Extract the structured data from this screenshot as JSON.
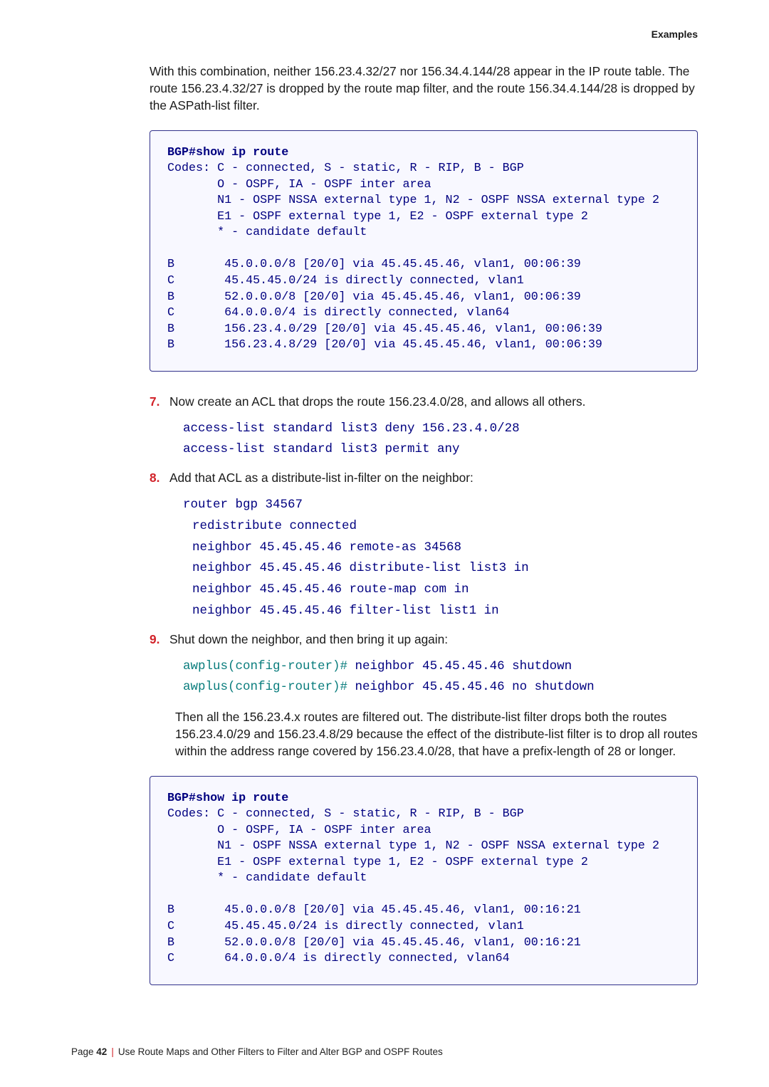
{
  "header": {
    "section": "Examples"
  },
  "intro": {
    "p1": "With this combination, neither 156.23.4.32/27 nor 156.34.4.144/28 appear in the IP route table. The route 156.23.4.32/27 is dropped by the route map filter, and the route 156.34.4.144/28 is dropped by the ASPath-list filter."
  },
  "codebox1": {
    "cmd": "BGP#show ip route",
    "body": "Codes: C - connected, S - static, R - RIP, B - BGP\n       O - OSPF, IA - OSPF inter area\n       N1 - OSPF NSSA external type 1, N2 - OSPF NSSA external type 2\n       E1 - OSPF external type 1, E2 - OSPF external type 2\n       * - candidate default\n\nB       45.0.0.0/8 [20/0] via 45.45.45.46, vlan1, 00:06:39\nC       45.45.45.0/24 is directly connected, vlan1\nB       52.0.0.0/8 [20/0] via 45.45.45.46, vlan1, 00:06:39\nC       64.0.0.0/4 is directly connected, vlan64\nB       156.23.4.0/29 [20/0] via 45.45.45.46, vlan1, 00:06:39\nB       156.23.4.8/29 [20/0] via 45.45.45.46, vlan1, 00:06:39"
  },
  "step7": {
    "num": "7.",
    "text": "Now create an ACL that drops the route 156.23.4.0/28, and allows all others.",
    "code": "access-list standard list3 deny 156.23.4.0/28\naccess-list standard list3 permit any"
  },
  "step8": {
    "num": "8.",
    "text": "Add that ACL as a distribute-list in-filter on the neighbor:",
    "code": {
      "l1": "router bgp 34567",
      "l2": "redistribute connected",
      "l3": "neighbor 45.45.45.46 remote-as 34568",
      "l4": "neighbor 45.45.45.46 distribute-list list3 in",
      "l5": "neighbor 45.45.45.46 route-map com in",
      "l6": "neighbor 45.45.45.46 filter-list list1 in"
    }
  },
  "step9": {
    "num": "9.",
    "text": "Shut down the neighbor, and then bring it up again:",
    "prompt1": "awplus(config-router)# ",
    "out1": "neighbor 45.45.45.46 shutdown",
    "prompt2": "awplus(config-router)# ",
    "out2": "neighbor 45.45.45.46 no shutdown",
    "para": "Then all the 156.23.4.x routes are filtered out. The distribute-list filter drops both the routes 156.23.4.0/29 and 156.23.4.8/29 because the effect of the distribute-list filter is to drop all routes within the address range covered by 156.23.4.0/28, that have a prefix-length of 28 or longer."
  },
  "codebox2": {
    "cmd": "BGP#show ip route",
    "body": "Codes: C - connected, S - static, R - RIP, B - BGP\n       O - OSPF, IA - OSPF inter area\n       N1 - OSPF NSSA external type 1, N2 - OSPF NSSA external type 2\n       E1 - OSPF external type 1, E2 - OSPF external type 2\n       * - candidate default\n\nB       45.0.0.0/8 [20/0] via 45.45.45.46, vlan1, 00:16:21\nC       45.45.45.0/24 is directly connected, vlan1\nB       52.0.0.0/8 [20/0] via 45.45.45.46, vlan1, 00:16:21\nC       64.0.0.0/4 is directly connected, vlan64"
  },
  "footer": {
    "page_label": "Page ",
    "page_number": "42",
    "title": "Use Route Maps and Other Filters to Filter and Alter BGP and OSPF Routes"
  }
}
